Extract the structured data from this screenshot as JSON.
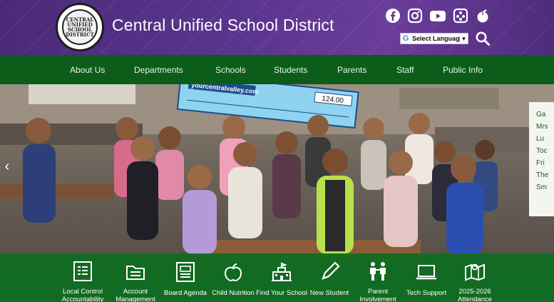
{
  "header": {
    "title": "Central Unified School District",
    "seal_text": "CENTRAL UNIFIED SCHOOL DISTRICT",
    "social": [
      {
        "name": "facebook-icon"
      },
      {
        "name": "instagram-icon"
      },
      {
        "name": "youtube-icon"
      },
      {
        "name": "app-icon"
      },
      {
        "name": "peachjar-icon"
      }
    ],
    "language": {
      "select_label": "Select Language",
      "arrow": "▼"
    }
  },
  "nav": {
    "items": [
      "About Us",
      "Departments",
      "Schools",
      "Students",
      "Parents",
      "Staff",
      "Public Info"
    ]
  },
  "hero": {
    "check_text": "yourcentralvalley.com",
    "check_amount": "124.00",
    "board_lines": [
      "Ga",
      "Mrs",
      "Lu",
      "Toc",
      "Fri",
      "The",
      "Sm"
    ],
    "prev": "‹",
    "next": "›"
  },
  "quick_links": [
    {
      "icon": "report-icon",
      "label": "Local Control Accountability"
    },
    {
      "icon": "folder-icon",
      "label": "Account Management"
    },
    {
      "icon": "agenda-icon",
      "label": "Board Agenda"
    },
    {
      "icon": "apple-icon",
      "label": "Child Nutrition"
    },
    {
      "icon": "school-icon",
      "label": "Find Your School"
    },
    {
      "icon": "pencil-icon",
      "label": "New Student"
    },
    {
      "icon": "parents-icon",
      "label": "Parent Involvement"
    },
    {
      "icon": "laptop-icon",
      "label": "Tech Support"
    },
    {
      "icon": "map-icon",
      "label": "2025-2026 Attendance"
    }
  ],
  "colors": {
    "header_purple": "#5b3590",
    "nav_green": "#0c5d1a",
    "quicklink_green": "#0e6e20"
  }
}
